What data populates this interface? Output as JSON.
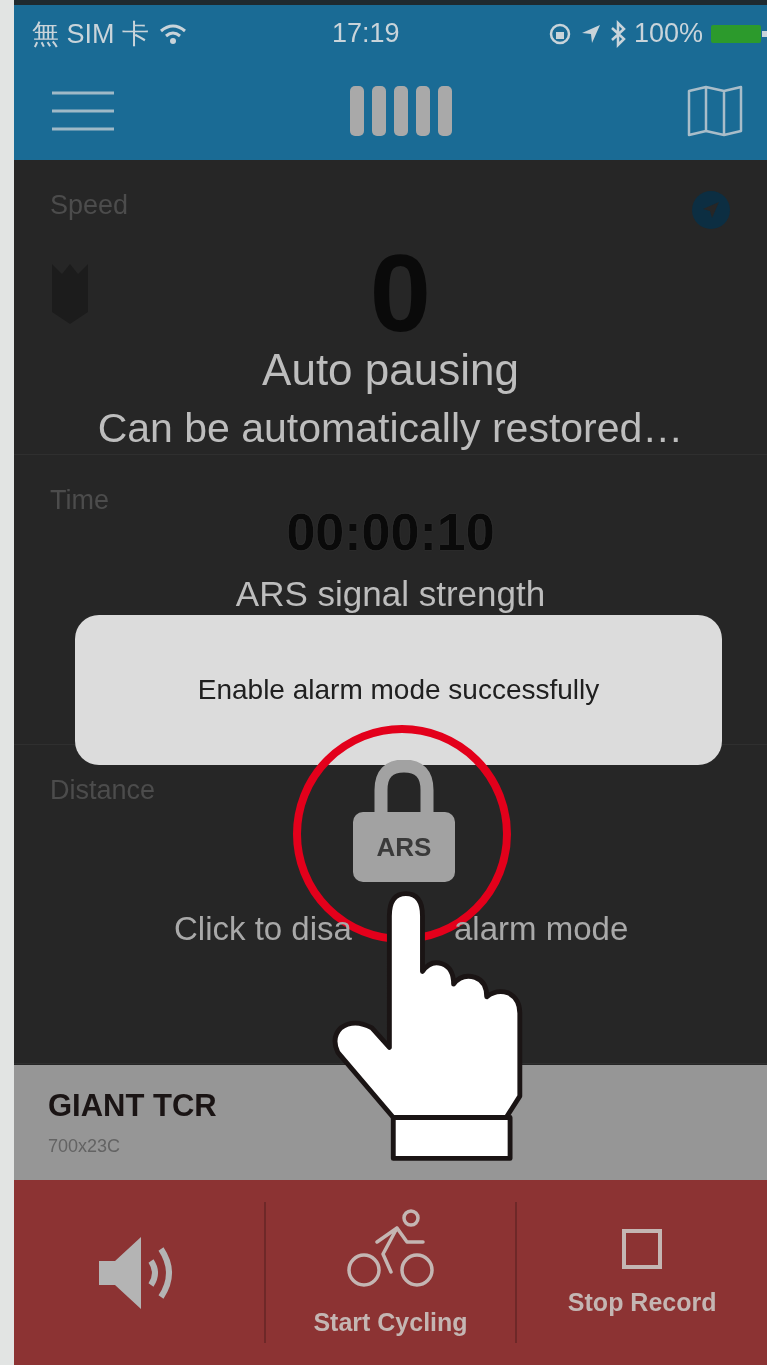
{
  "status_bar": {
    "carrier": "無 SIM 卡",
    "time": "17:19",
    "battery": "100%"
  },
  "metrics": [
    {
      "label": "Speed",
      "value": "0"
    },
    {
      "label": "Time",
      "value": "00:00:10"
    },
    {
      "label": "Distance"
    }
  ],
  "overlay": {
    "pause_title": "Auto pausing",
    "pause_message": "Can be automatically restored…",
    "signal_label": "ARS signal strength",
    "lock_label": "ARS",
    "hint_start": "Click to disa",
    "hint_end": "alarm mode"
  },
  "toast": {
    "message": "Enable alarm mode successfully"
  },
  "bike": {
    "name": "GIANT TCR",
    "tire": "700x23C"
  },
  "bottom_bar": [
    {
      "kind": "sound"
    },
    {
      "kind": "cycle",
      "label": "Start Cycling"
    },
    {
      "kind": "stop",
      "label": "Stop Record"
    }
  ]
}
